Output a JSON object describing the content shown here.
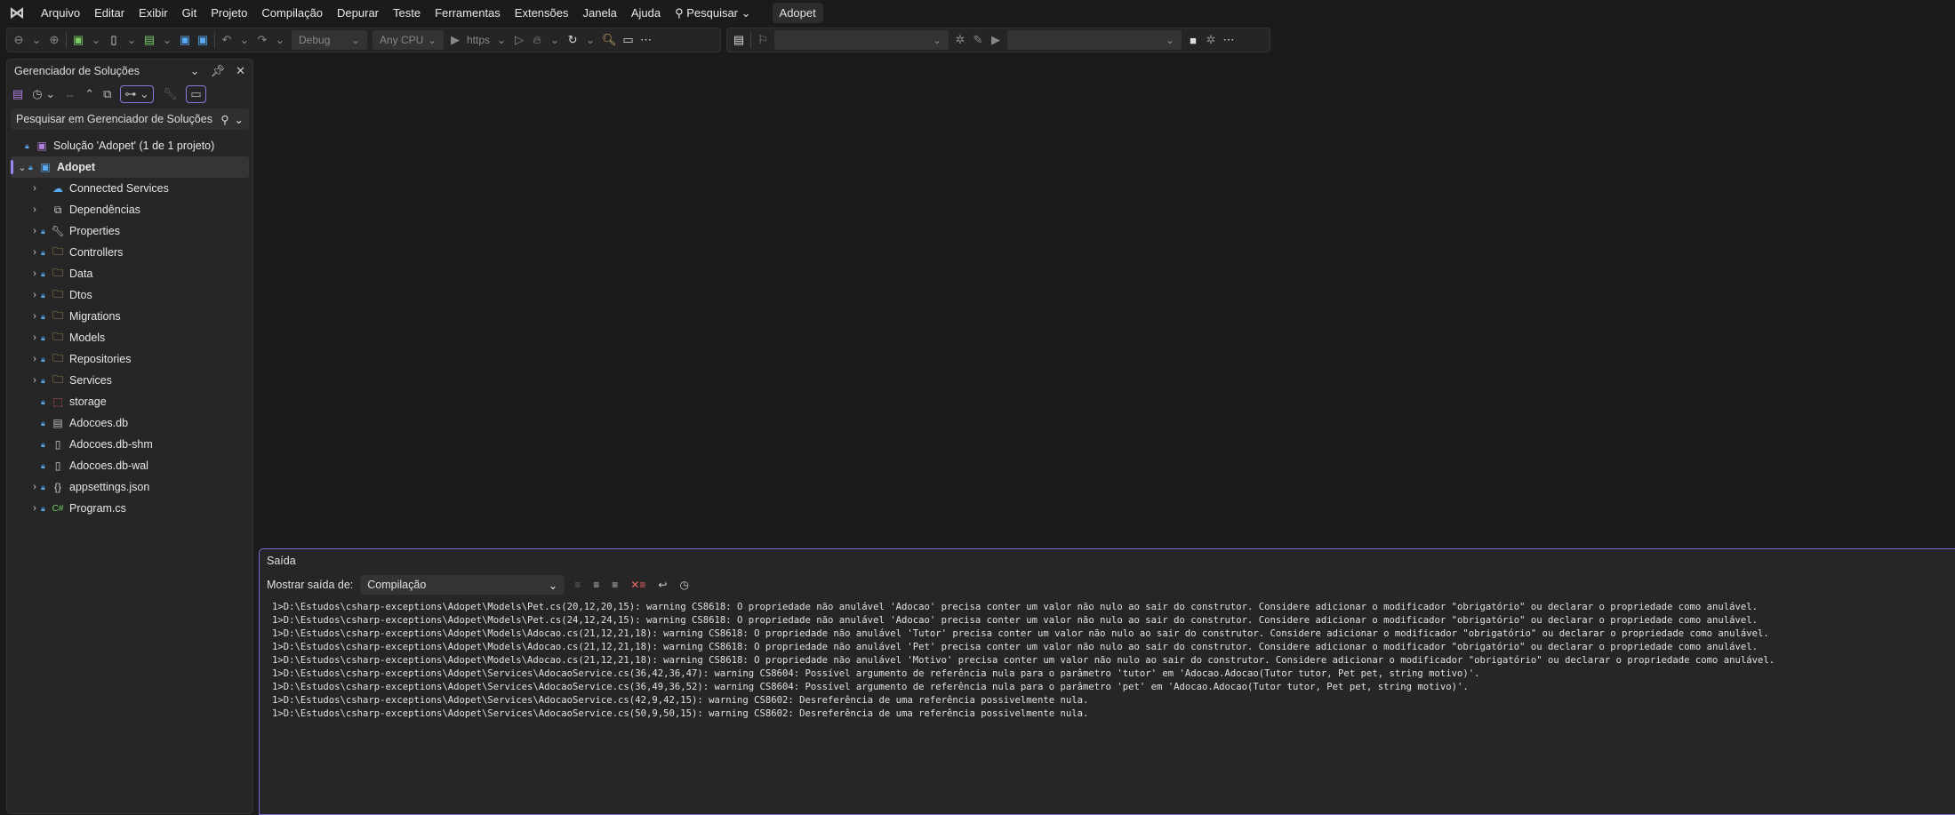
{
  "menu": {
    "items": [
      "Arquivo",
      "Editar",
      "Exibir",
      "Git",
      "Projeto",
      "Compilação",
      "Depurar",
      "Teste",
      "Ferramentas",
      "Extensões",
      "Janela",
      "Ajuda"
    ],
    "search": "Pesquisar",
    "title": "Adopet"
  },
  "toolbar": {
    "config": "Debug",
    "platform": "Any CPU",
    "run": "https"
  },
  "solution_explorer": {
    "title": "Gerenciador de Soluções",
    "search_placeholder": "Pesquisar em Gerenciador de Soluções (C",
    "solution": "Solução 'Adopet' (1 de 1 projeto)",
    "project": "Adopet",
    "items": [
      {
        "label": "Connected Services",
        "icon": "cloud-icon",
        "expandable": true,
        "lock": false
      },
      {
        "label": "Dependências",
        "icon": "dependencies-icon",
        "expandable": true,
        "lock": false
      },
      {
        "label": "Properties",
        "icon": "wrench-folder-icon",
        "expandable": true,
        "lock": true
      },
      {
        "label": "Controllers",
        "icon": "folder-icon",
        "expandable": true,
        "lock": true
      },
      {
        "label": "Data",
        "icon": "folder-icon",
        "expandable": true,
        "lock": true
      },
      {
        "label": "Dtos",
        "icon": "folder-icon",
        "expandable": true,
        "lock": true
      },
      {
        "label": "Migrations",
        "icon": "folder-icon",
        "expandable": true,
        "lock": true
      },
      {
        "label": "Models",
        "icon": "folder-icon",
        "expandable": true,
        "lock": true
      },
      {
        "label": "Repositories",
        "icon": "folder-icon",
        "expandable": true,
        "lock": true
      },
      {
        "label": "Services",
        "icon": "folder-icon",
        "expandable": true,
        "lock": true
      },
      {
        "label": "storage",
        "icon": "missing-folder-icon",
        "expandable": false,
        "lock": true
      },
      {
        "label": "Adocoes.db",
        "icon": "db-file-icon",
        "expandable": false,
        "lock": true
      },
      {
        "label": "Adocoes.db-shm",
        "icon": "file-icon",
        "expandable": false,
        "lock": true
      },
      {
        "label": "Adocoes.db-wal",
        "icon": "file-icon",
        "expandable": false,
        "lock": true
      },
      {
        "label": "appsettings.json",
        "icon": "json-icon",
        "expandable": true,
        "lock": true
      },
      {
        "label": "Program.cs",
        "icon": "csharp-icon",
        "expandable": true,
        "lock": true
      }
    ]
  },
  "output": {
    "title": "Saída",
    "show_from_label": "Mostrar saída de:",
    "source": "Compilação",
    "lines": [
      "1>D:\\Estudos\\csharp-exceptions\\Adopet\\Models\\Pet.cs(20,12,20,15): warning CS8618: O propriedade não anulável 'Adocao' precisa conter um valor não nulo ao sair do construtor. Considere adicionar o modificador \"obrigatório\" ou declarar o propriedade como anulável.",
      "1>D:\\Estudos\\csharp-exceptions\\Adopet\\Models\\Pet.cs(24,12,24,15): warning CS8618: O propriedade não anulável 'Adocao' precisa conter um valor não nulo ao sair do construtor. Considere adicionar o modificador \"obrigatório\" ou declarar o propriedade como anulável.",
      "1>D:\\Estudos\\csharp-exceptions\\Adopet\\Models\\Adocao.cs(21,12,21,18): warning CS8618: O propriedade não anulável 'Tutor' precisa conter um valor não nulo ao sair do construtor. Considere adicionar o modificador \"obrigatório\" ou declarar o propriedade como anulável.",
      "1>D:\\Estudos\\csharp-exceptions\\Adopet\\Models\\Adocao.cs(21,12,21,18): warning CS8618: O propriedade não anulável 'Pet' precisa conter um valor não nulo ao sair do construtor. Considere adicionar o modificador \"obrigatório\" ou declarar o propriedade como anulável.",
      "1>D:\\Estudos\\csharp-exceptions\\Adopet\\Models\\Adocao.cs(21,12,21,18): warning CS8618: O propriedade não anulável 'Motivo' precisa conter um valor não nulo ao sair do construtor. Considere adicionar o modificador \"obrigatório\" ou declarar o propriedade como anulável.",
      "1>D:\\Estudos\\csharp-exceptions\\Adopet\\Services\\AdocaoService.cs(36,42,36,47): warning CS8604: Possível argumento de referência nula para o parâmetro 'tutor' em 'Adocao.Adocao(Tutor tutor, Pet pet, string motivo)'.",
      "1>D:\\Estudos\\csharp-exceptions\\Adopet\\Services\\AdocaoService.cs(36,49,36,52): warning CS8604: Possível argumento de referência nula para o parâmetro 'pet' em 'Adocao.Adocao(Tutor tutor, Pet pet, string motivo)'.",
      "1>D:\\Estudos\\csharp-exceptions\\Adopet\\Services\\AdocaoService.cs(42,9,42,15): warning CS8602: Desreferência de uma referência possivelmente nula.",
      "1>D:\\Estudos\\csharp-exceptions\\Adopet\\Services\\AdocaoService.cs(50,9,50,15): warning CS8602: Desreferência de uma referência possivelmente nula."
    ]
  }
}
